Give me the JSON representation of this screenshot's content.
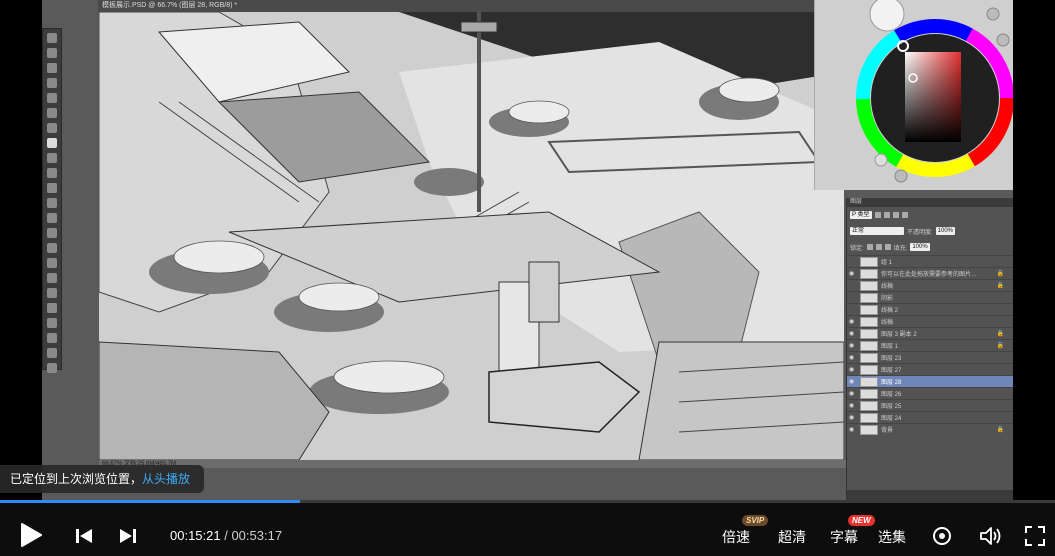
{
  "photoshop": {
    "document_tab": "模板展示.PSD @ 66.7% (图层 28, RGB/8) *",
    "status_text": "66.67%    文档:25.6M/485.7M",
    "layers_panel": {
      "title": "图层",
      "kind_filter": "P 类型",
      "blend_mode": "正常",
      "opacity_label": "不透明度:",
      "opacity_value": "100%",
      "lock_label": "锁定:",
      "fill_label": "填充:",
      "fill_value": "100%",
      "layers": [
        {
          "name": "组 1",
          "visible": false,
          "locked": false,
          "selected": false
        },
        {
          "name": "你可以在此处拖放需要参考的图片…",
          "visible": true,
          "locked": true,
          "selected": false
        },
        {
          "name": "线稿",
          "visible": false,
          "locked": true,
          "selected": false
        },
        {
          "name": "阴影",
          "visible": false,
          "locked": false,
          "selected": false
        },
        {
          "name": "线稿 2",
          "visible": false,
          "locked": false,
          "selected": false
        },
        {
          "name": "线稿",
          "visible": true,
          "locked": false,
          "selected": false
        },
        {
          "name": "图层 3 副本 2",
          "visible": true,
          "locked": true,
          "selected": false
        },
        {
          "name": "图层 1",
          "visible": true,
          "locked": true,
          "selected": false
        },
        {
          "name": "图层 23",
          "visible": true,
          "locked": false,
          "selected": false
        },
        {
          "name": "图层 27",
          "visible": true,
          "locked": false,
          "selected": false
        },
        {
          "name": "图层 28",
          "visible": true,
          "locked": false,
          "selected": true
        },
        {
          "name": "图层 26",
          "visible": true,
          "locked": false,
          "selected": false
        },
        {
          "name": "图层 25",
          "visible": true,
          "locked": false,
          "selected": false
        },
        {
          "name": "图层 24",
          "visible": true,
          "locked": false,
          "selected": false
        },
        {
          "name": "背景",
          "visible": true,
          "locked": true,
          "selected": false
        }
      ]
    },
    "color_wheel": {
      "hue_color": "#e23030"
    }
  },
  "toast": {
    "message": "已定位到上次浏览位置，",
    "link": "从头播放"
  },
  "player": {
    "progress_fraction": 0.284,
    "current_time": "00:15:21",
    "separator": " / ",
    "duration": "00:53:17",
    "speed_label": "倍速",
    "speed_badge": "SVIP",
    "quality_label": "超清",
    "subtitle_label": "字幕",
    "subtitle_badge": "NEW",
    "episodes_label": "选集",
    "colors": {
      "accent": "#2f8cff",
      "toast_link": "#3fa9f5",
      "svip_badge": "#6b4a2a",
      "new_badge": "#e8322e"
    }
  }
}
